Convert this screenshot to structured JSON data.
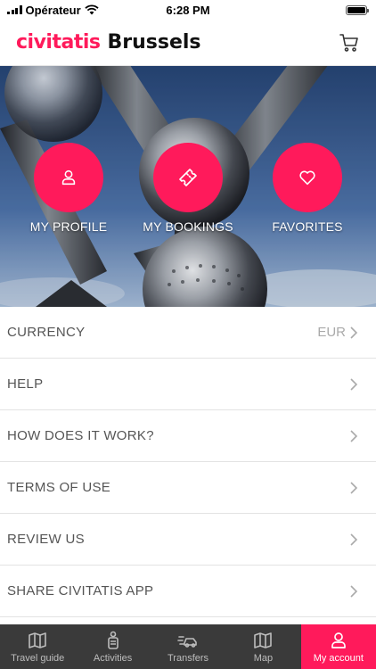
{
  "status": {
    "carrier": "Opérateur",
    "time": "6:28 PM"
  },
  "header": {
    "brand": "civitatis",
    "city": "Brussels"
  },
  "hero": {
    "actions": [
      {
        "label": "MY PROFILE",
        "icon": "person-icon"
      },
      {
        "label": "MY BOOKINGS",
        "icon": "ticket-icon"
      },
      {
        "label": "FAVORITES",
        "icon": "heart-icon"
      }
    ]
  },
  "menu": {
    "items": [
      {
        "label": "CURRENCY",
        "value": "EUR"
      },
      {
        "label": "HELP"
      },
      {
        "label": "HOW DOES IT WORK?"
      },
      {
        "label": "TERMS OF USE"
      },
      {
        "label": "REVIEW US"
      },
      {
        "label": "SHARE CIVITATIS APP"
      }
    ]
  },
  "tabs": [
    {
      "label": "Travel guide",
      "icon": "guide-map-icon"
    },
    {
      "label": "Activities",
      "icon": "activities-icon"
    },
    {
      "label": "Transfers",
      "icon": "transfers-car-icon"
    },
    {
      "label": "Map",
      "icon": "map-icon"
    },
    {
      "label": "My account",
      "icon": "account-icon",
      "active": true
    }
  ],
  "colors": {
    "accent": "#ff1a5b",
    "tab_bar": "#3a3a3a"
  }
}
